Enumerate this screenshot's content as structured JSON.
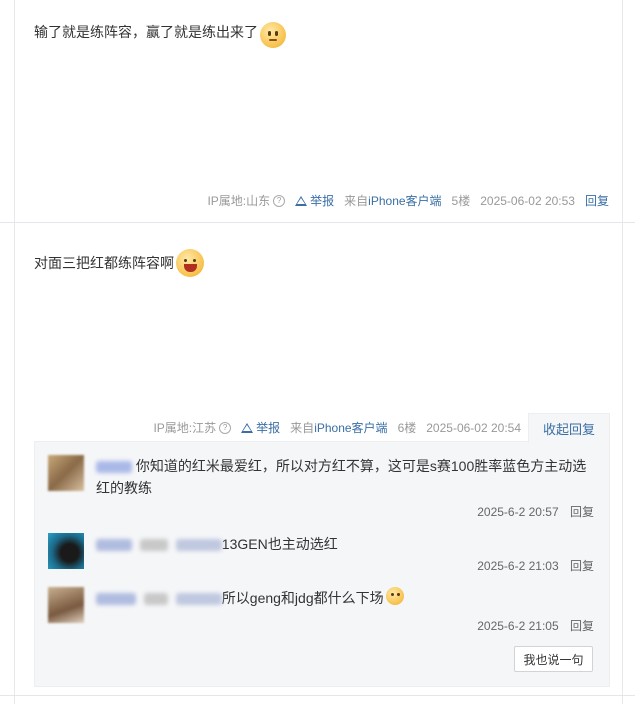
{
  "posts": [
    {
      "text": "输了就是练阵容，赢了就是练出来了",
      "emoji": "smug-face-emoji",
      "ip": "IP属地:山东",
      "report": "举报",
      "from_prefix": "来自",
      "client": "iPhone客户端",
      "floor": "5楼",
      "time": "2025-06-02 20:53",
      "reply": "回复"
    },
    {
      "text": "对面三把红都练阵容啊",
      "emoji": "laughing-face-emoji",
      "ip": "IP属地:江苏",
      "report": "举报",
      "from_prefix": "来自",
      "client": "iPhone客户端",
      "floor": "6楼",
      "time": "2025-06-02 20:54",
      "collapse": "收起回复"
    }
  ],
  "replies": [
    {
      "text": "你知道的红米最爱红，所以对方红不算，这可是s赛100胜率蓝色方主动选红的教练",
      "time": "2025-6-2 20:57",
      "reply": "回复"
    },
    {
      "text": "13GEN也主动选红",
      "time": "2025-6-2 21:03",
      "reply": "回复"
    },
    {
      "text": "所以geng和jdg都什么下场",
      "time": "2025-6-2 21:05",
      "reply": "回复"
    }
  ],
  "say_button": "我也说一句",
  "colors": {
    "link": "#3a6ea5",
    "muted": "#999999",
    "reply_bg": "#f5f6f8"
  }
}
